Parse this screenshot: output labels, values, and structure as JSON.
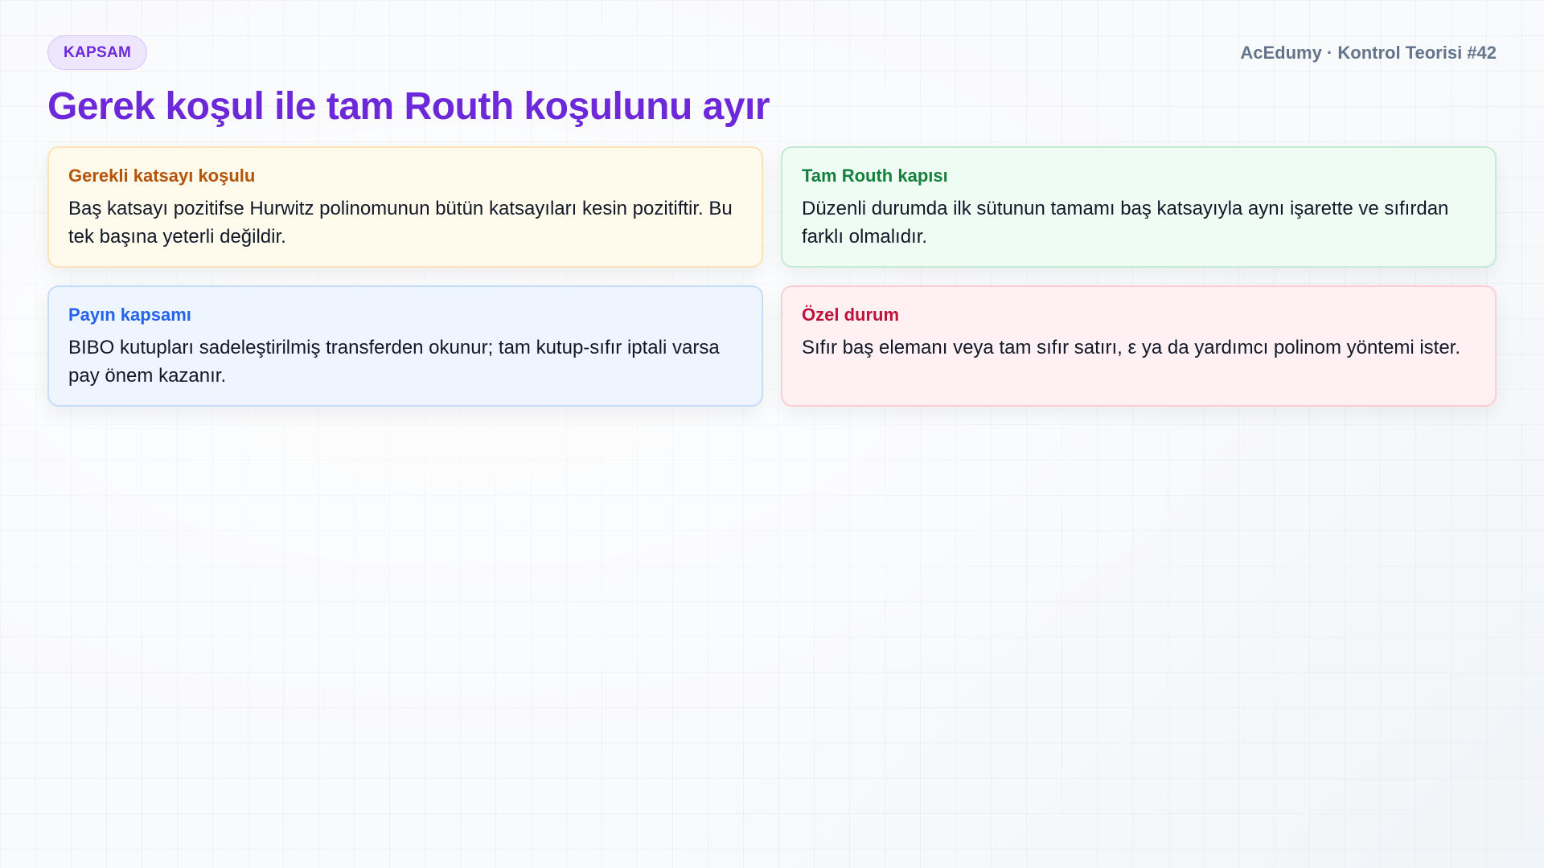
{
  "header": {
    "badge": "KAPSAM",
    "brand": "AcEdumy · Kontrol Teorisi #42",
    "title": "Gerek koşul ile tam Routh koşulunu ayır"
  },
  "cards": [
    {
      "title": "Gerekli katsayı koşulu",
      "body": "Baş katsayı pozitifse Hurwitz polinomunun bütün katsayıları kesin pozitiftir. Bu tek başına yeterli değildir.",
      "accent": "#b45309"
    },
    {
      "title": "Tam Routh kapısı",
      "body": "Düzenli durumda ilk sütunun tamamı baş katsayıyla aynı işarette ve sıfırdan farklı olmalıdır.",
      "accent": "#15803d"
    },
    {
      "title": "Payın kapsamı",
      "body": "BIBO kutupları sadeleştirilmiş transferden okunur; tam kutup-sıfır iptali varsa pay önem kazanır.",
      "accent": "#2563eb"
    },
    {
      "title": "Özel durum",
      "body": "Sıfır baş elemanı veya tam sıfır satırı, ε ya da yardımcı polinom yöntemi ister.",
      "accent": "#be123c"
    }
  ]
}
